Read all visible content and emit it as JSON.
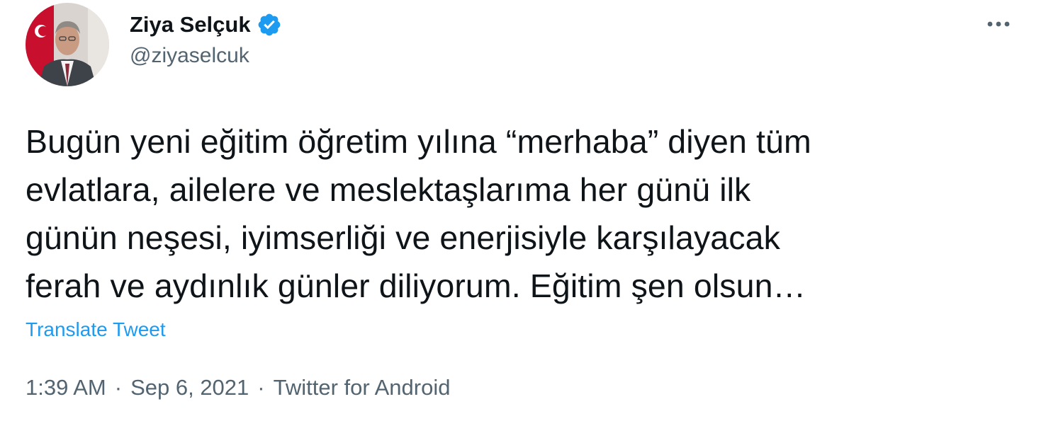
{
  "author": {
    "display_name": "Ziya Selçuk",
    "handle": "@ziyaselcuk",
    "verified": true,
    "verified_color": "#1d9bf0",
    "avatar_icon": "profile-photo"
  },
  "menu": {
    "icon": "more-horizontal-icon"
  },
  "tweet": {
    "text": "Bugün yeni eğitim öğretim yılına “merhaba” diyen tüm\nevlatlara, ailelere ve meslektaşlarıma her günü ilk\ngünün neşesi, iyimserliği ve enerjisiyle karşılayacak\nferah ve aydınlık günler diliyorum. Eğitim şen olsun…",
    "translate_label": "Translate Tweet",
    "time": "1:39 AM",
    "separator": "·",
    "date": "Sep 6, 2021",
    "source": "Twitter for Android"
  },
  "colors": {
    "primary_text": "#0f1419",
    "secondary_text": "#536471",
    "link": "#1d9bf0"
  }
}
